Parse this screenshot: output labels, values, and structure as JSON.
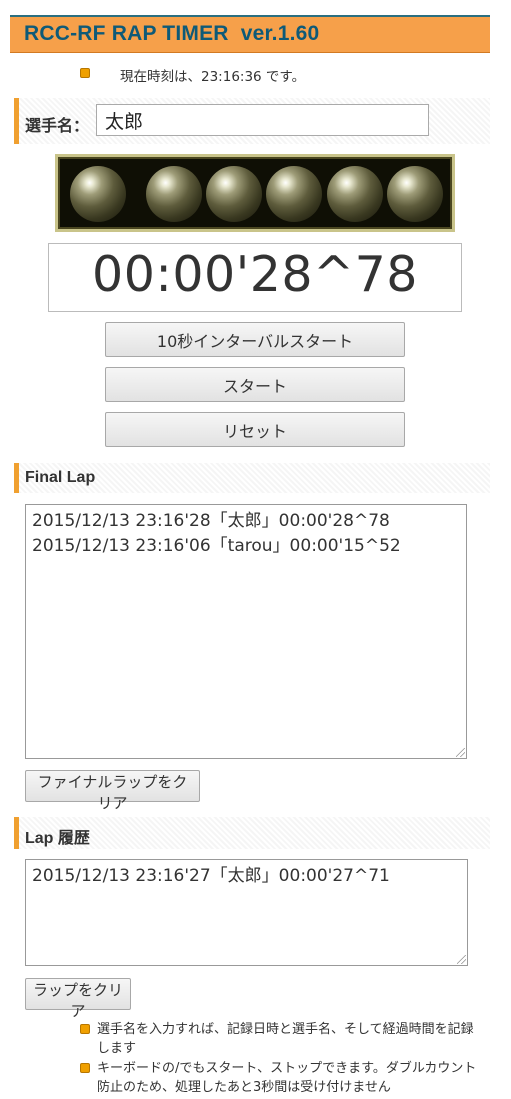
{
  "header": {
    "title": "RCC-RF RAP TIMER  ver.1.60"
  },
  "clock": {
    "text": "現在時刻は、23:16:36 です。"
  },
  "racer": {
    "label": "選手名：",
    "value": "太郎"
  },
  "timer": {
    "display": "00:00'28^78"
  },
  "buttons": {
    "interval": "10秒インターバルスタート",
    "start": "スタート",
    "reset": "リセット",
    "clear_final": "ファイナルラップをクリア",
    "clear_lap": "ラップをクリア"
  },
  "final_lap": {
    "title": "Final Lap",
    "entries": [
      "2015/12/13 23:16'28「太郎」00:00'28^78",
      "2015/12/13 23:16'06「tarou」00:00'15^52"
    ]
  },
  "lap_history": {
    "title": "Lap 履歴",
    "entries": [
      "2015/12/13 23:16'27「太郎」00:00'27^71"
    ]
  },
  "notes": [
    "選手名を入力すれば、記録日時と選手名、そして経過時間を記録します",
    "キーボードの/でもスタート、ストップできます。ダブルカウント防止のため、処理したあと3秒間は受け付けません"
  ],
  "colors": {
    "accent": "#f6a04a",
    "title_text": "#0e5a78",
    "section_border": "#f0a030"
  },
  "icons": {
    "bullet": "orange-square-bullet-icon",
    "signal_light": "signal-light-icon"
  }
}
